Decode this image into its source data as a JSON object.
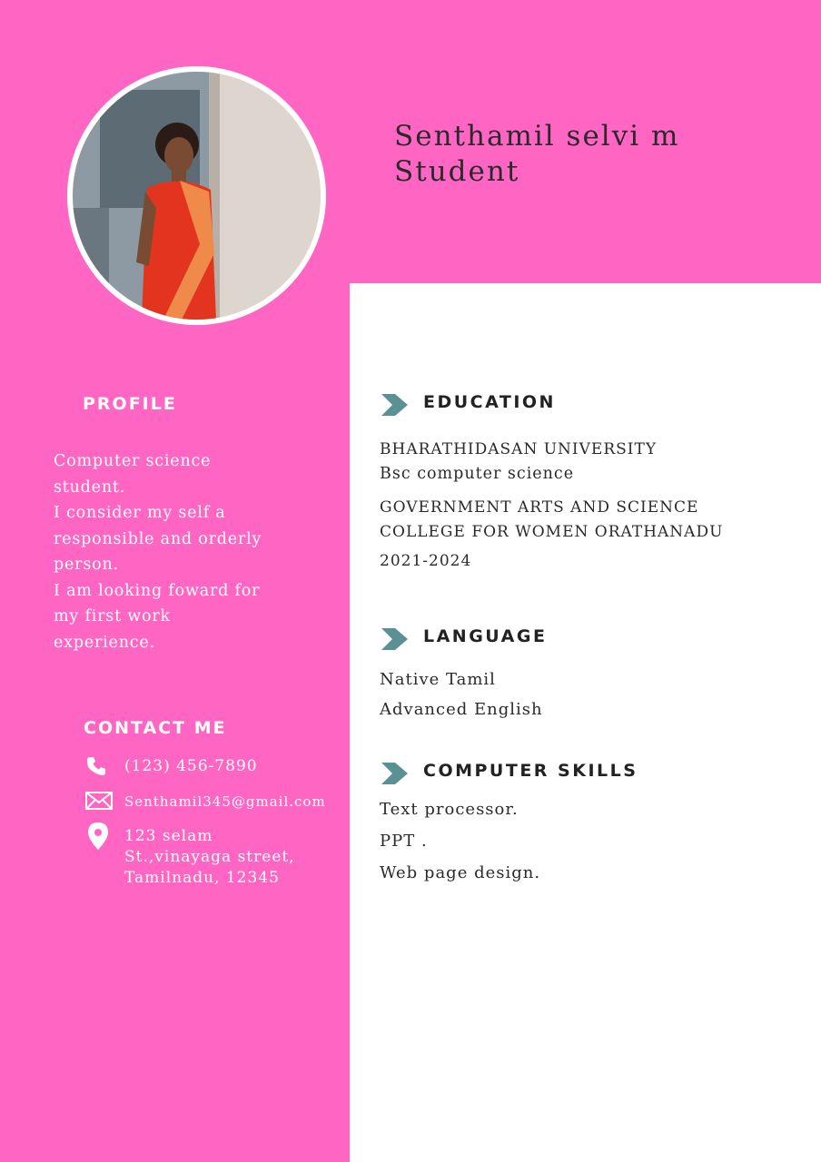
{
  "header": {
    "name": "Senthamil selvi m",
    "role": "Student"
  },
  "colors": {
    "accent_pink": "#ff66c4",
    "chevron": "#5b9095",
    "text_dark": "#2a2a2a"
  },
  "profile": {
    "heading": "PROFILE",
    "lines": [
      "Computer science",
      "student.",
      "I consider my self a",
      "responsible and orderly",
      "person.",
      "I am looking foward for",
      "my first work",
      "experience."
    ]
  },
  "contact": {
    "heading": "CONTACT ME",
    "phone": "(123) 456-7890",
    "email": "Senthamil345@gmail.com",
    "address": [
      "123 selam",
      "St.,vinayaga street,",
      "Tamilnadu,  12345"
    ],
    "icons": [
      "phone-icon",
      "mail-icon",
      "location-pin-icon"
    ]
  },
  "education": {
    "heading": "EDUCATION",
    "university": "BHARATHIDASAN UNIVERSITY",
    "degree": "Bsc computer science",
    "college_line1": "GOVERNMENT ARTS AND SCIENCE",
    "college_line2": "COLLEGE FOR WOMEN ORATHANADU",
    "years": "2021-2024"
  },
  "language": {
    "heading": "LANGUAGE",
    "items": [
      "Native Tamil",
      "Advanced English"
    ]
  },
  "skills": {
    "heading": "COMPUTER SKILLS",
    "items": [
      "Text processor.",
      "PPT .",
      "Web page design."
    ]
  }
}
